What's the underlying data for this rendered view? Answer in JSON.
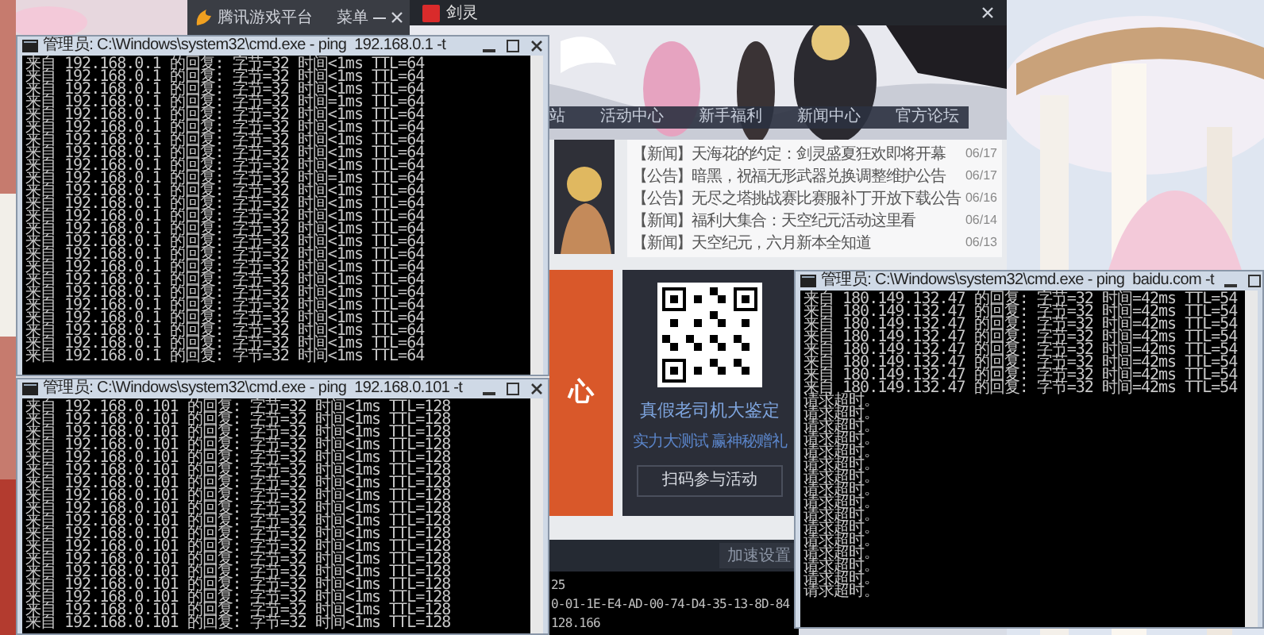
{
  "game_platform": {
    "title": "腾讯游戏平台",
    "menu": "菜单"
  },
  "game_launcher": {
    "title": "剑灵",
    "nav": [
      {
        "label": "站"
      },
      {
        "label": "活动中心"
      },
      {
        "label": "新手福利"
      },
      {
        "label": "新闻中心"
      },
      {
        "label": "官方论坛"
      }
    ],
    "news": [
      {
        "title": "【新闻】天海花的约定：剑灵盛夏狂欢即将开幕",
        "date": "06/17"
      },
      {
        "title": "【公告】暗黑，祝福无形武器兑换调整维护公告",
        "date": "06/17"
      },
      {
        "title": "【公告】无尽之塔挑战赛比赛服补丁开放下载公告",
        "date": "06/16"
      },
      {
        "title": "【新闻】福利大集合：天空纪元活动这里看",
        "date": "06/14"
      },
      {
        "title": "【新闻】天空纪元，六月新本全知道",
        "date": "06/13"
      }
    ],
    "promo": {
      "text": "心"
    },
    "qr_card": {
      "title": "真假老司机大鉴定",
      "subtitle": "实力大测试 赢神秘赠礼",
      "button": "扫码参与活动"
    },
    "settings_button": "加速设置"
  },
  "background_console": {
    "lines": [
      "25",
      "0-01-1E-E4-AD-00-74-D4-35-13-8D-84",
      "128.166"
    ]
  },
  "consoles": [
    {
      "title": "管理员: C:\\Windows\\system32\\cmd.exe - ping  192.168.0.1 -t",
      "lines": [
        "来自 192.168.0.1 的回复: 字节=32 时间<1ms TTL=64",
        "来自 192.168.0.1 的回复: 字节=32 时间<1ms TTL=64",
        "来自 192.168.0.1 的回复: 字节=32 时间<1ms TTL=64",
        "来自 192.168.0.1 的回复: 字节=32 时间=1ms TTL=64",
        "来自 192.168.0.1 的回复: 字节=32 时间<1ms TTL=64",
        "来自 192.168.0.1 的回复: 字节=32 时间<1ms TTL=64",
        "来自 192.168.0.1 的回复: 字节=32 时间<1ms TTL=64",
        "来自 192.168.0.1 的回复: 字节=32 时间<1ms TTL=64",
        "来自 192.168.0.1 的回复: 字节=32 时间<1ms TTL=64",
        "来自 192.168.0.1 的回复: 字节=32 时间=1ms TTL=64",
        "来自 192.168.0.1 的回复: 字节=32 时间<1ms TTL=64",
        "来自 192.168.0.1 的回复: 字节=32 时间<1ms TTL=64",
        "来自 192.168.0.1 的回复: 字节=32 时间<1ms TTL=64",
        "来自 192.168.0.1 的回复: 字节=32 时间<1ms TTL=64",
        "来自 192.168.0.1 的回复: 字节=32 时间<1ms TTL=64",
        "来自 192.168.0.1 的回复: 字节=32 时间<1ms TTL=64",
        "来自 192.168.0.1 的回复: 字节=32 时间<1ms TTL=64",
        "来自 192.168.0.1 的回复: 字节=32 时间<1ms TTL=64",
        "来自 192.168.0.1 的回复: 字节=32 时间<1ms TTL=64",
        "来自 192.168.0.1 的回复: 字节=32 时间<1ms TTL=64",
        "来自 192.168.0.1 的回复: 字节=32 时间<1ms TTL=64",
        "来自 192.168.0.1 的回复: 字节=32 时间<1ms TTL=64",
        "来自 192.168.0.1 的回复: 字节=32 时间<1ms TTL=64",
        "来自 192.168.0.1 的回复: 字节=32 时间<1ms TTL=64"
      ]
    },
    {
      "title": "管理员: C:\\Windows\\system32\\cmd.exe - ping  192.168.0.101 -t",
      "lines": [
        "来自 192.168.0.101 的回复: 字节=32 时间<1ms TTL=128",
        "来自 192.168.0.101 的回复: 字节=32 时间<1ms TTL=128",
        "来自 192.168.0.101 的回复: 字节=32 时间<1ms TTL=128",
        "来自 192.168.0.101 的回复: 字节=32 时间<1ms TTL=128",
        "来自 192.168.0.101 的回复: 字节=32 时间<1ms TTL=128",
        "来自 192.168.0.101 的回复: 字节=32 时间<1ms TTL=128",
        "来自 192.168.0.101 的回复: 字节=32 时间<1ms TTL=128",
        "来自 192.168.0.101 的回复: 字节=32 时间<1ms TTL=128",
        "来自 192.168.0.101 的回复: 字节=32 时间<1ms TTL=128",
        "来自 192.168.0.101 的回复: 字节=32 时间<1ms TTL=128",
        "来自 192.168.0.101 的回复: 字节=32 时间<1ms TTL=128",
        "来自 192.168.0.101 的回复: 字节=32 时间<1ms TTL=128",
        "来自 192.168.0.101 的回复: 字节=32 时间<1ms TTL=128",
        "来自 192.168.0.101 的回复: 字节=32 时间<1ms TTL=128",
        "来自 192.168.0.101 的回复: 字节=32 时间<1ms TTL=128",
        "来自 192.168.0.101 的回复: 字节=32 时间<1ms TTL=128",
        "来自 192.168.0.101 的回复: 字节=32 时间<1ms TTL=128",
        "来自 192.168.0.101 的回复: 字节=32 时间<1ms TTL=128"
      ]
    },
    {
      "title": "管理员: C:\\Windows\\system32\\cmd.exe - ping  baidu.com -t",
      "lines": [
        "来自 180.149.132.47 的回复: 字节=32 时间=42ms TTL=54",
        "来自 180.149.132.47 的回复: 字节=32 时间=42ms TTL=54",
        "来自 180.149.132.47 的回复: 字节=32 时间=42ms TTL=54",
        "来自 180.149.132.47 的回复: 字节=32 时间=42ms TTL=54",
        "来自 180.149.132.47 的回复: 字节=32 时间=42ms TTL=54",
        "来自 180.149.132.47 的回复: 字节=32 时间=42ms TTL=54",
        "来自 180.149.132.47 的回复: 字节=32 时间=42ms TTL=54",
        "来自 180.149.132.47 的回复: 字节=32 时间=42ms TTL=54",
        "请求超时。",
        "请求超时。",
        "请求超时。",
        "请求超时。",
        "请求超时。",
        "请求超时。",
        "请求超时。",
        "请求超时。",
        "请求超时。",
        "请求超时。",
        "请求超时。",
        "请求超时。",
        "请求超时。",
        "请求超时。",
        "请求超时。",
        "请求超时。"
      ]
    }
  ]
}
